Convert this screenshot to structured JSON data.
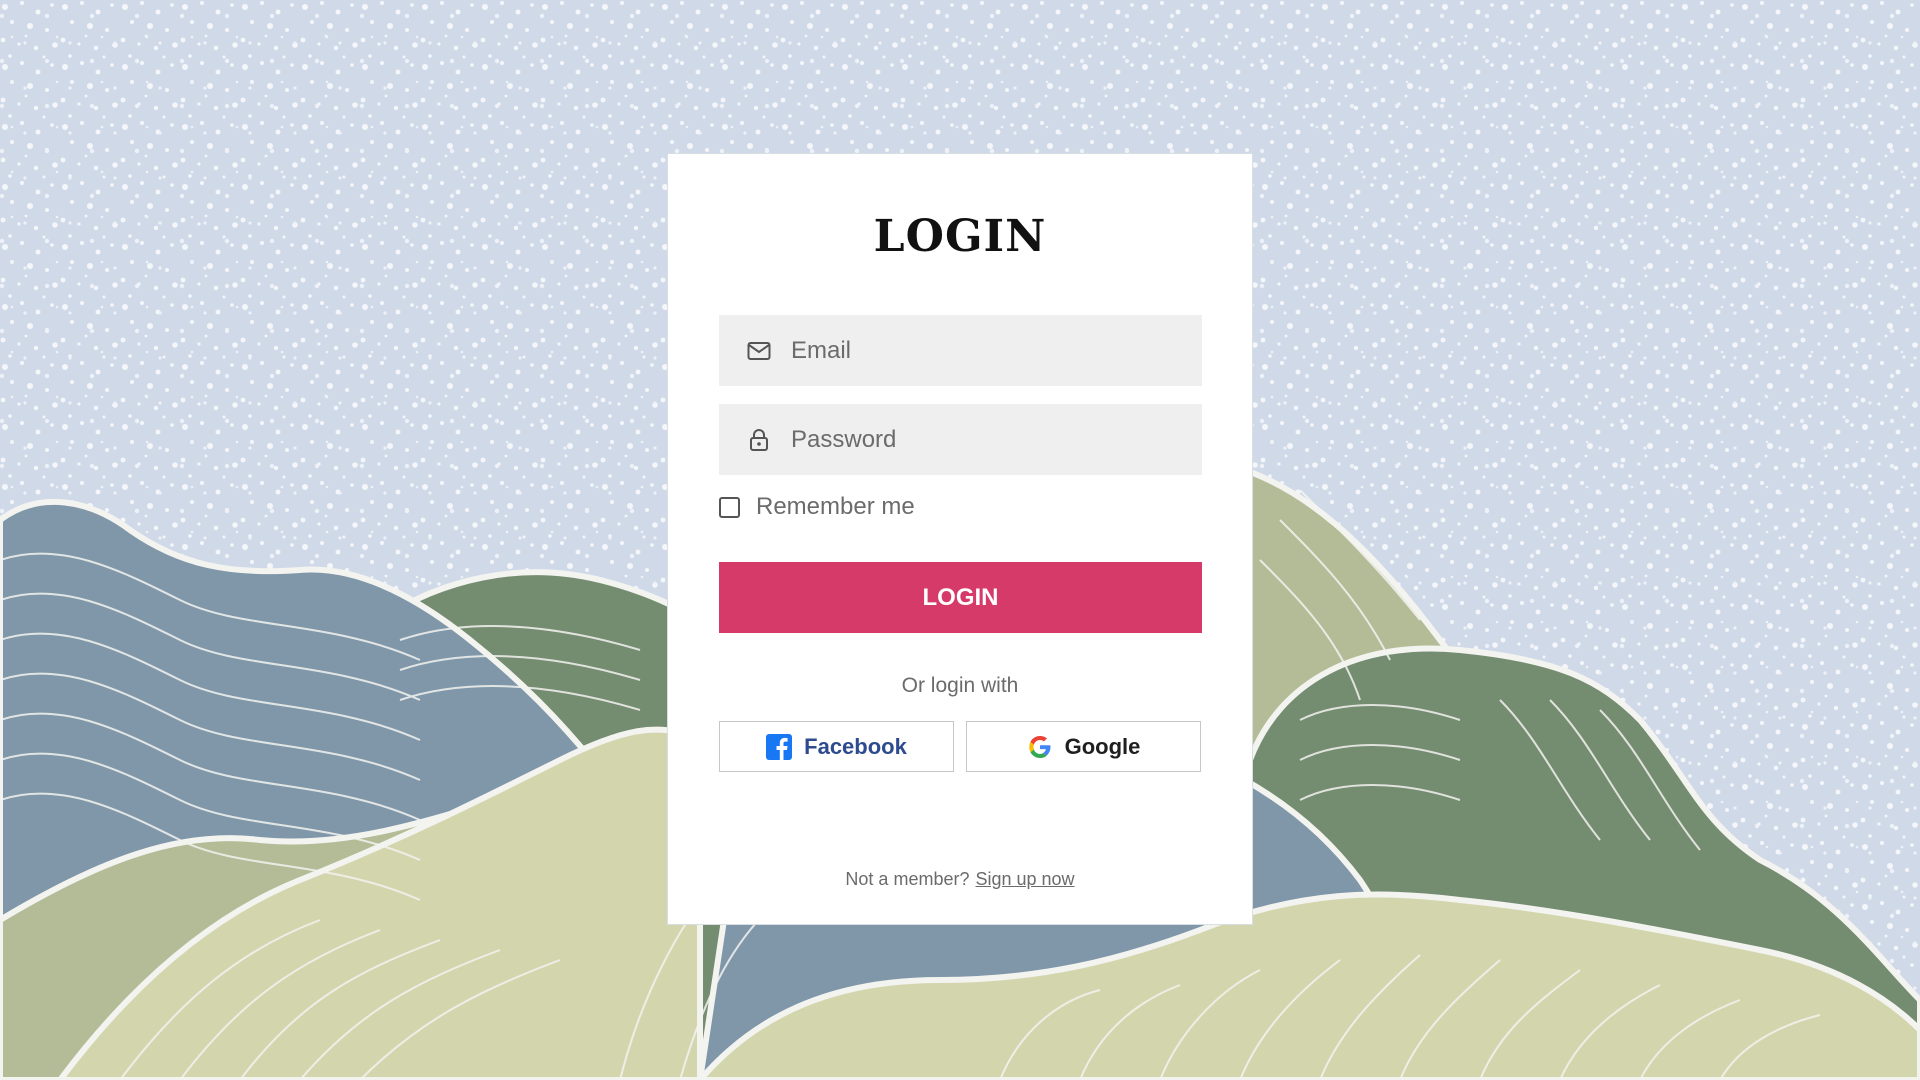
{
  "login_card": {
    "title": "LOGIN",
    "email_placeholder": "Email",
    "password_placeholder": "Password",
    "remember_label": "Remember me",
    "login_button_label": "LOGIN",
    "or_login_with": "Or login with",
    "facebook_label": "Facebook",
    "google_label": "Google",
    "not_member_text": "Not a member?",
    "signup_link_text": "Sign up now"
  },
  "colors": {
    "sky": "#cfd9e8",
    "login_button": "#d63a69",
    "hill_blue": "#7f97a8",
    "hill_green": "#748c70",
    "hill_sage": "#b3bc96",
    "hill_cream": "#d3d6ad",
    "facebook_blue": "#1877f2"
  },
  "icons": {
    "email": "mail-icon",
    "password": "lock-icon",
    "facebook": "facebook-logo-icon",
    "google": "google-logo-icon"
  }
}
